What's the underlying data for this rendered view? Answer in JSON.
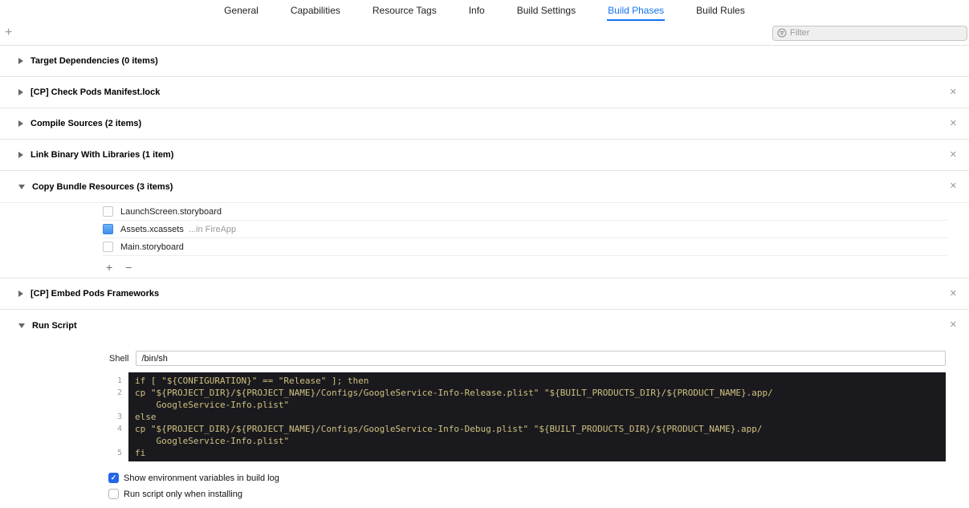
{
  "tabs": [
    {
      "label": "General",
      "active": false
    },
    {
      "label": "Capabilities",
      "active": false
    },
    {
      "label": "Resource Tags",
      "active": false
    },
    {
      "label": "Info",
      "active": false
    },
    {
      "label": "Build Settings",
      "active": false
    },
    {
      "label": "Build Phases",
      "active": true
    },
    {
      "label": "Build Rules",
      "active": false
    }
  ],
  "toolbar": {
    "filter_placeholder": "Filter"
  },
  "icons": {
    "add": "+",
    "minus": "−",
    "close": "✕",
    "check": "✓"
  },
  "phases": [
    {
      "title": "Target Dependencies (0 items)",
      "expanded": false,
      "closable": false
    },
    {
      "title": "[CP] Check Pods Manifest.lock",
      "expanded": false,
      "closable": true
    },
    {
      "title": "Compile Sources (2 items)",
      "expanded": false,
      "closable": true
    },
    {
      "title": "Link Binary With Libraries (1 item)",
      "expanded": false,
      "closable": true
    },
    {
      "title": "Copy Bundle Resources (3 items)",
      "expanded": true,
      "closable": true,
      "files": [
        {
          "name": "LaunchScreen.storyboard",
          "note": ""
        },
        {
          "name": "Assets.xcassets",
          "note": "...in FireApp"
        },
        {
          "name": "Main.storyboard",
          "note": ""
        }
      ]
    },
    {
      "title": "[CP] Embed Pods Frameworks",
      "expanded": false,
      "closable": true
    },
    {
      "title": "Run Script",
      "expanded": true,
      "closable": true
    }
  ],
  "run_script": {
    "shell_label": "Shell",
    "shell_value": "/bin/sh",
    "lines": [
      {
        "num": "1",
        "code": "if [ \"${CONFIGURATION}\" == \"Release\" ]; then"
      },
      {
        "num": "2",
        "code": "cp \"${PROJECT_DIR}/${PROJECT_NAME}/Configs/GoogleService-Info-Release.plist\" \"${BUILT_PRODUCTS_DIR}/${PRODUCT_NAME}.app/\n    GoogleService-Info.plist\""
      },
      {
        "num": "3",
        "code": "else"
      },
      {
        "num": "4",
        "code": "cp \"${PROJECT_DIR}/${PROJECT_NAME}/Configs/GoogleService-Info-Debug.plist\" \"${BUILT_PRODUCTS_DIR}/${PRODUCT_NAME}.app/\n    GoogleService-Info.plist\""
      },
      {
        "num": "5",
        "code": "fi"
      }
    ],
    "options": [
      {
        "label": "Show environment variables in build log",
        "checked": true
      },
      {
        "label": "Run script only when installing",
        "checked": false
      }
    ]
  },
  "colors": {
    "accent_blue": "#1574f2",
    "code_background": "#1a1a1e",
    "code_text": "#d0c080",
    "checkbox_blue": "#2566e8"
  }
}
